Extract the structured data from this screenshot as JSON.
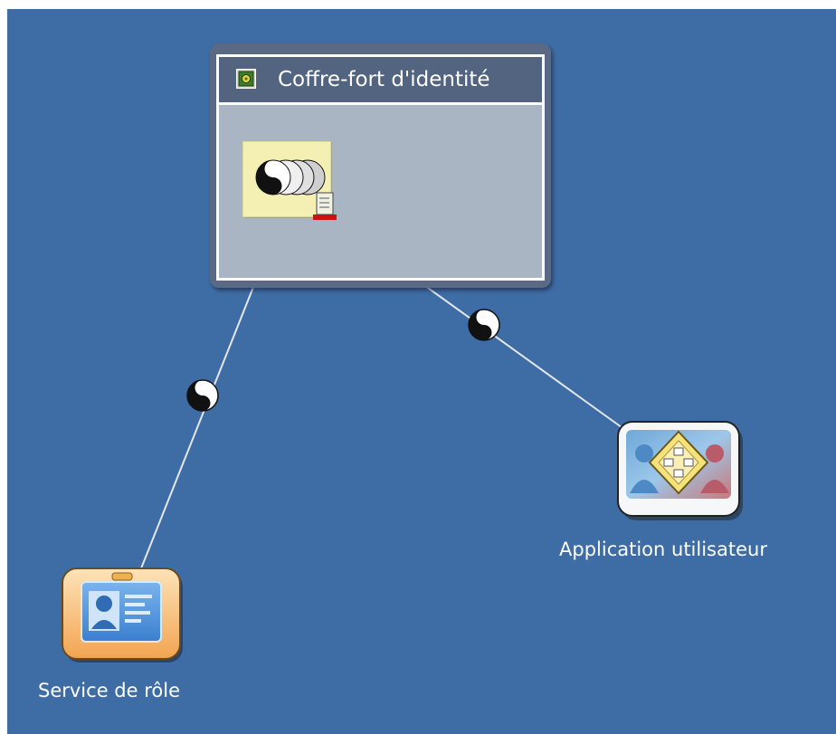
{
  "canvas": {
    "background_color": "#3e6ca5"
  },
  "vault": {
    "title": "Coffre-fort d'identité",
    "header_icon": "vault-icon",
    "frame_color": "#5a6a86",
    "body_color": "#aab5c4"
  },
  "drivers": {
    "icon": "driver-set-icon"
  },
  "nodes": {
    "role_service": {
      "label": "Service de rôle",
      "icon": "id-badge-icon"
    },
    "user_application": {
      "label": "Application utilisateur",
      "icon": "user-application-icon"
    }
  },
  "connections": [
    {
      "from": "drivers",
      "to": "role_service",
      "icon": "yin-yang-icon"
    },
    {
      "from": "drivers",
      "to": "user_application",
      "icon": "yin-yang-icon"
    }
  ]
}
